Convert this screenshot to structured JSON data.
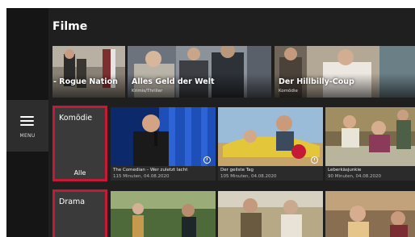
{
  "sidebar": {
    "menu_label": "MENU"
  },
  "page_title": "Filme",
  "hero_tiles": [
    {
      "title": "- Rogue Nation",
      "subtitle": ""
    },
    {
      "title": "Alles Geld der Welt",
      "subtitle": "Krimis/Thriller"
    },
    {
      "title": "Der Hillbilly-Coup",
      "subtitle": "Komödie"
    }
  ],
  "rows": [
    {
      "category": "Komödie",
      "all_label": "Alle",
      "items": [
        {
          "title": "The Comedian – Wer zuletzt lacht",
          "meta": "115 Minuten, 04.08.2020"
        },
        {
          "title": "Der geilste Tag",
          "meta": "105 Minuten, 04.08.2020"
        },
        {
          "title": "Leberkäsjunkie",
          "meta": "90 Minuten, 04.08.2020"
        }
      ]
    },
    {
      "category": "Drama"
    }
  ],
  "colors": {
    "accent": "#c51a35",
    "background": "#1f1f1f",
    "sidebar": "#151515"
  }
}
